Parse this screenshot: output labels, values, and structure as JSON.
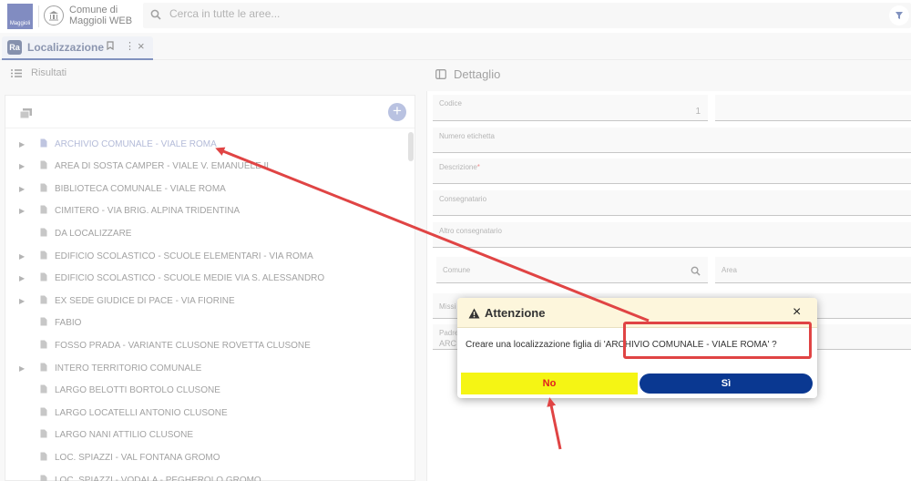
{
  "header": {
    "logo_text": "Maggioli",
    "app_title": "Comune di Maggioli WEB",
    "search_placeholder": "Cerca in tutte le aree..."
  },
  "tab": {
    "badge": "Ra",
    "label": "Localizzazione"
  },
  "left_panel": {
    "title": "Risultati",
    "items": [
      {
        "label": "ARCHIVIO COMUNALE - VIALE ROMA",
        "expandable": true,
        "selected": true
      },
      {
        "label": "AREA DI SOSTA CAMPER - VIALE V. EMANUELE II",
        "expandable": true
      },
      {
        "label": "BIBLIOTECA COMUNALE - VIALE ROMA",
        "expandable": true
      },
      {
        "label": "CIMITERO - VIA BRIG. ALPINA TRIDENTINA",
        "expandable": true
      },
      {
        "label": "DA LOCALIZZARE",
        "expandable": false
      },
      {
        "label": "EDIFICIO SCOLASTICO -  SCUOLE ELEMENTARI -  VIA ROMA",
        "expandable": true
      },
      {
        "label": "EDIFICIO SCOLASTICO - SCUOLE MEDIE VIA S. ALESSANDRO",
        "expandable": true
      },
      {
        "label": "EX SEDE GIUDICE DI PACE - VIA FIORINE",
        "expandable": true
      },
      {
        "label": "FABIO",
        "expandable": false
      },
      {
        "label": "FOSSO PRADA - VARIANTE CLUSONE ROVETTA  CLUSONE",
        "expandable": false
      },
      {
        "label": "INTERO TERRITORIO COMUNALE",
        "expandable": true
      },
      {
        "label": "LARGO BELOTTI BORTOLO CLUSONE",
        "expandable": false
      },
      {
        "label": "LARGO LOCATELLI ANTONIO CLUSONE",
        "expandable": false
      },
      {
        "label": "LARGO NANI ATTILIO CLUSONE",
        "expandable": false
      },
      {
        "label": "LOC.  SPIAZZI - VAL FONTANA  GROMO",
        "expandable": false
      },
      {
        "label": "LOC.  SPIAZZI - VODALA - PEGHEROLO  GROMO",
        "expandable": false
      }
    ]
  },
  "right_panel": {
    "title": "Dettaglio",
    "fields": {
      "codice_label": "Codice",
      "codice_value": "1",
      "numero_label": "Numero etichetta",
      "descrizione_label": "Descrizione",
      "consegnatario_label": "Consegnatario",
      "altro_label": "Altro consegnatario",
      "comune_label": "Comune",
      "area_label": "Area",
      "missione_label": "Missi",
      "padre_label": "Padre",
      "padre_value": "ARC"
    }
  },
  "dialog": {
    "title": "Attenzione",
    "message": "Creare una localizzazione figlia di 'ARCHIVIO COMUNALE - VIALE ROMA' ?",
    "no_label": "No",
    "si_label": "Sì"
  },
  "colors": {
    "primary": "#0a3891",
    "highlight": "#f5f514",
    "annotation": "#e04444",
    "dialog_header": "#fdf6dc"
  }
}
